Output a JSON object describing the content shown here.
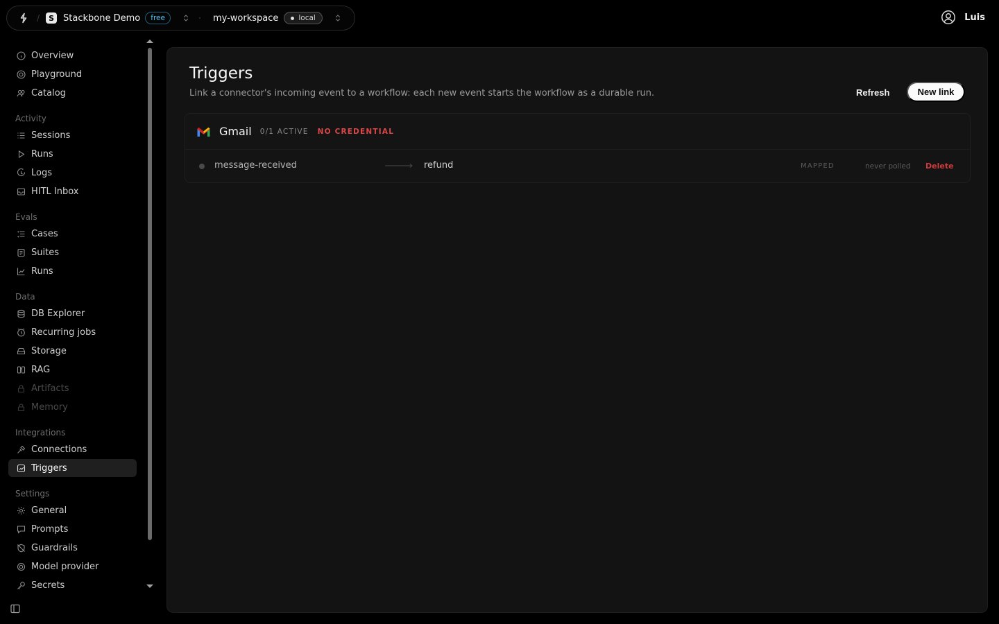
{
  "header": {
    "org": {
      "avatar_letter": "S",
      "name": "Stackbone Demo",
      "plan": "free"
    },
    "workspace": {
      "name": "my-workspace",
      "env": "local"
    },
    "user": {
      "name": "Luis"
    }
  },
  "sidebar": {
    "top_items": [
      {
        "label": "Overview",
        "icon": "info-icon"
      },
      {
        "label": "Playground",
        "icon": "target-icon"
      },
      {
        "label": "Catalog",
        "icon": "users-icon"
      }
    ],
    "sections": [
      {
        "label": "Activity",
        "items": [
          {
            "label": "Sessions",
            "icon": "list-icon"
          },
          {
            "label": "Runs",
            "icon": "play-icon"
          },
          {
            "label": "Logs",
            "icon": "log-icon"
          },
          {
            "label": "HITL Inbox",
            "icon": "inbox-icon"
          }
        ]
      },
      {
        "label": "Evals",
        "items": [
          {
            "label": "Cases",
            "icon": "list-check-icon"
          },
          {
            "label": "Suites",
            "icon": "folder-icon"
          },
          {
            "label": "Runs",
            "icon": "chart-icon"
          }
        ]
      },
      {
        "label": "Data",
        "items": [
          {
            "label": "DB Explorer",
            "icon": "database-icon"
          },
          {
            "label": "Recurring jobs",
            "icon": "clock-icon"
          },
          {
            "label": "Storage",
            "icon": "storage-icon"
          },
          {
            "label": "RAG",
            "icon": "rag-icon"
          },
          {
            "label": "Artifacts",
            "icon": "lock-icon",
            "disabled": true
          },
          {
            "label": "Memory",
            "icon": "lock-icon",
            "disabled": true
          }
        ]
      },
      {
        "label": "Integrations",
        "items": [
          {
            "label": "Connections",
            "icon": "plug-icon"
          },
          {
            "label": "Triggers",
            "icon": "trigger-icon",
            "active": true
          }
        ]
      },
      {
        "label": "Settings",
        "items": [
          {
            "label": "General",
            "icon": "gear-icon"
          },
          {
            "label": "Prompts",
            "icon": "message-icon"
          },
          {
            "label": "Guardrails",
            "icon": "shield-off-icon"
          },
          {
            "label": "Model provider",
            "icon": "provider-icon"
          },
          {
            "label": "Secrets",
            "icon": "key-icon"
          }
        ]
      }
    ]
  },
  "main": {
    "title": "Triggers",
    "subtitle": "Link a connector's incoming event to a workflow: each new event starts the workflow as a durable run.",
    "refresh_label": "Refresh",
    "new_link_label": "New link",
    "connectors": [
      {
        "name": "Gmail",
        "active_count": "0/1 ACTIVE",
        "credential_status": "NO CREDENTIAL",
        "triggers": [
          {
            "event": "message-received",
            "workflow": "refund",
            "mapping_status": "MAPPED",
            "poll_status": "never polled",
            "delete_label": "Delete"
          }
        ]
      }
    ]
  },
  "colors": {
    "accent_badge": "#4fc3f7",
    "danger": "#e04545",
    "panel_bg": "#131313",
    "page_bg": "#000000"
  }
}
